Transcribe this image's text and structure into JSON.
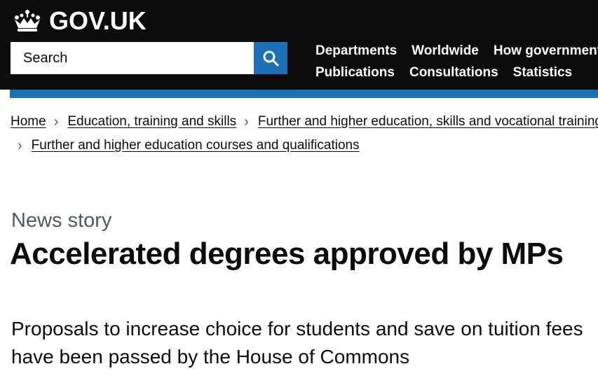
{
  "header": {
    "logo_text": "GOV.UK",
    "crown_icon": "crown-icon",
    "search": {
      "placeholder": "Search",
      "button_icon": "search-icon"
    },
    "nav_rows": [
      [
        "Departments",
        "Worldwide",
        "How government works"
      ],
      [
        "Publications",
        "Consultations",
        "Statistics"
      ]
    ],
    "colors": {
      "background": "#0b0c0c",
      "accent": "#1d70b8"
    }
  },
  "breadcrumbs": {
    "items": [
      "Home",
      "Education, training and skills",
      "Further and higher education, skills and vocational training",
      "Further and higher education courses and qualifications"
    ]
  },
  "article": {
    "caption": "News story",
    "title": "Accelerated degrees approved by MPs",
    "lead": "Proposals to increase choice for students and save on tuition fees have been passed by the House of Commons"
  }
}
